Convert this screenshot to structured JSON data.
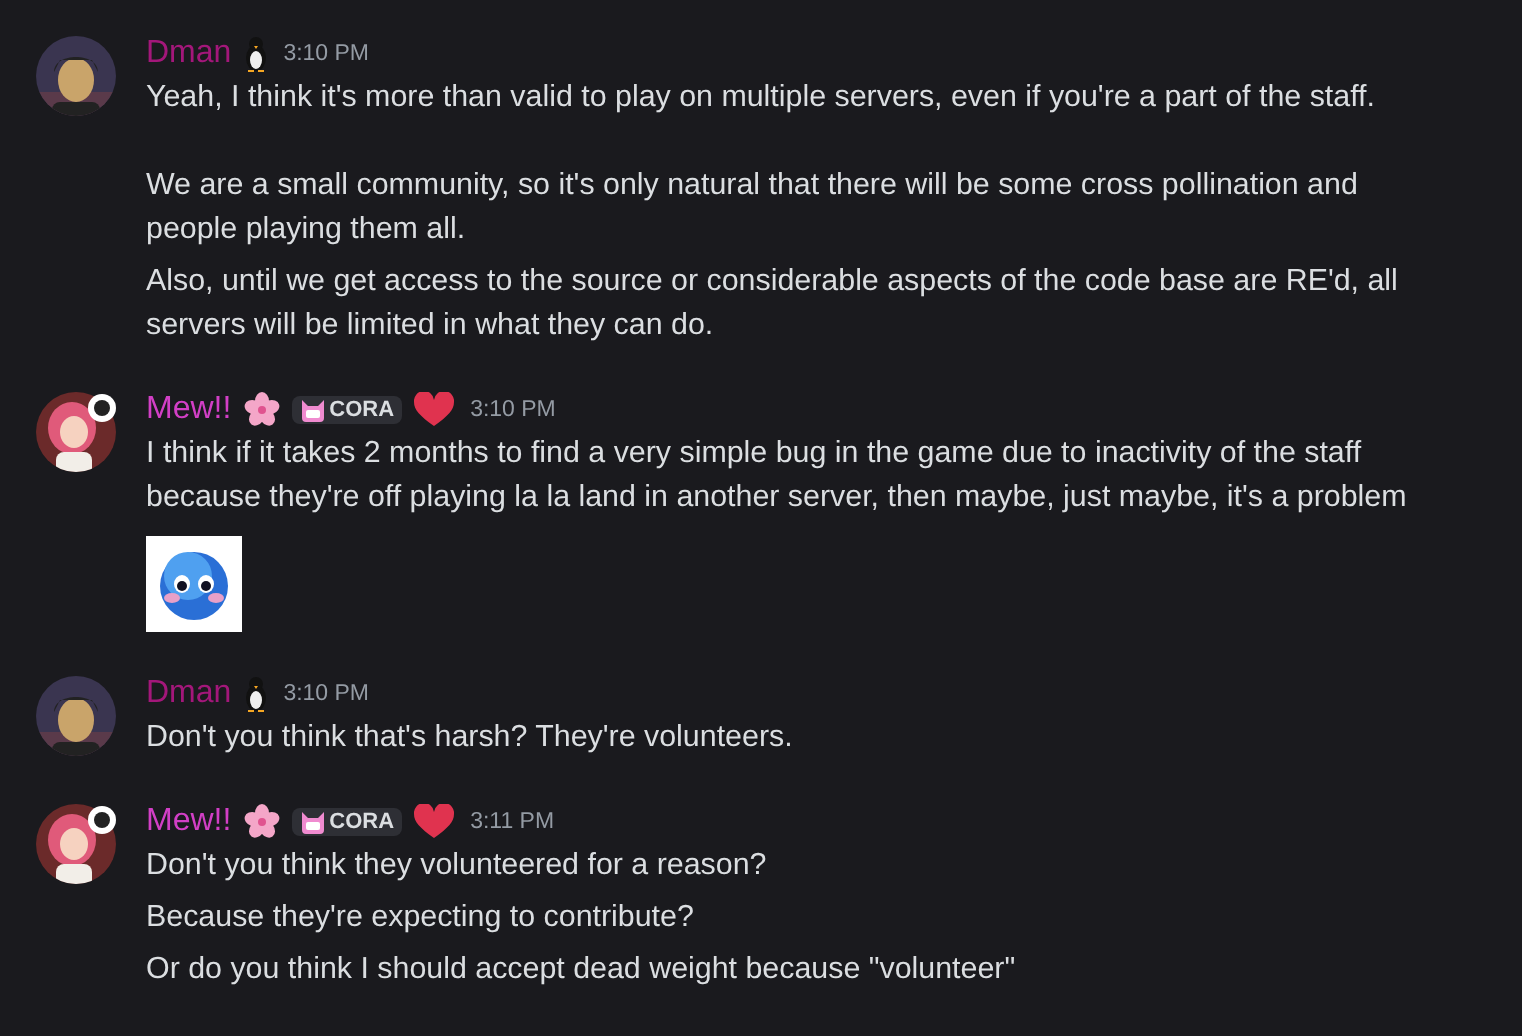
{
  "messages": [
    {
      "author": "Dman",
      "color": "#a3177a",
      "avatar": {
        "kind": "dark"
      },
      "badges": [
        {
          "kind": "penguin"
        }
      ],
      "time": "3:10 PM",
      "lines": [
        "Yeah, I think it's more than valid to play on multiple servers, even if you're a part of the staff.\n\nWe are a small community, so it's only natural that there will be some cross pollination and people playing them all.",
        "Also, until we get access to the source or considerable aspects of the code base are RE'd, all servers will be limited in what they can do."
      ]
    },
    {
      "author": "Mew!!",
      "color": "#d23fc6",
      "avatar": {
        "kind": "pink"
      },
      "badges": [
        {
          "kind": "flower"
        },
        {
          "kind": "tag",
          "label": "CORA"
        },
        {
          "kind": "heart"
        }
      ],
      "time": "3:10 PM",
      "lines": [
        "I think if it takes 2 months to find a very simple bug in the game due to inactivity of the staff because they're off playing la la land in another server, then maybe, just maybe, it's a problem"
      ],
      "attachment": {
        "kind": "picture"
      }
    },
    {
      "author": "Dman",
      "color": "#a3177a",
      "avatar": {
        "kind": "dark"
      },
      "badges": [
        {
          "kind": "penguin"
        }
      ],
      "time": "3:10 PM",
      "lines": [
        "Don't you think that's harsh? They're volunteers."
      ]
    },
    {
      "author": "Mew!!",
      "color": "#d23fc6",
      "avatar": {
        "kind": "pink"
      },
      "badges": [
        {
          "kind": "flower"
        },
        {
          "kind": "tag",
          "label": "CORA"
        },
        {
          "kind": "heart"
        }
      ],
      "time": "3:11 PM",
      "lines": [
        "Don't you think they volunteered for a reason?",
        "Because they're expecting to contribute?",
        "Or do you think I should accept dead weight because \"volunteer\""
      ]
    }
  ]
}
